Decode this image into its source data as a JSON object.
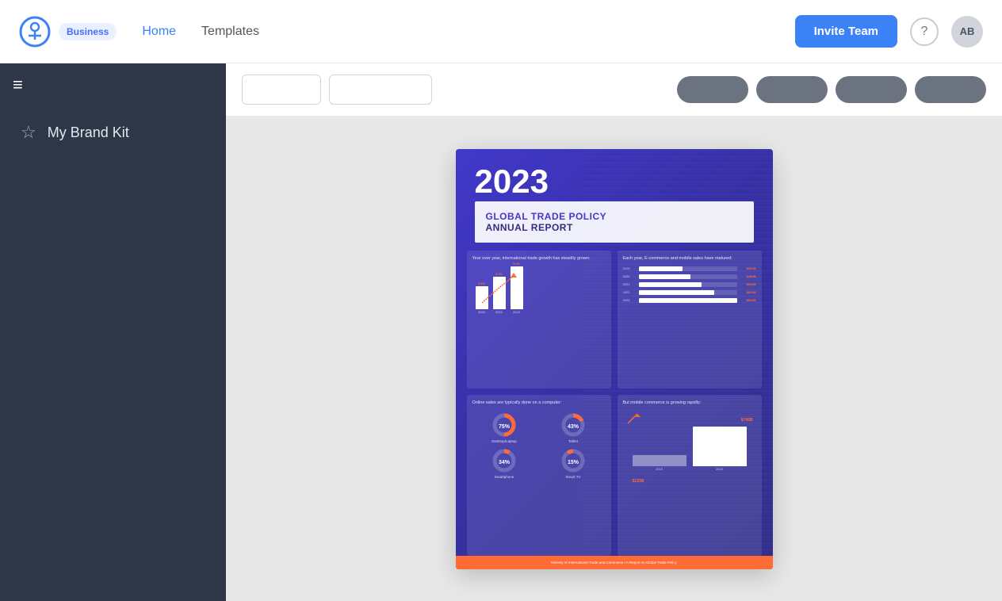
{
  "header": {
    "logo_badge": "Business",
    "nav_items": [
      {
        "label": "Home",
        "active": true
      },
      {
        "label": "Templates",
        "active": false
      }
    ],
    "invite_btn": "Invite Team",
    "help_icon": "?",
    "avatar_initials": "AB"
  },
  "sidebar": {
    "menu_icon": "≡",
    "items": [
      {
        "icon": "★",
        "label": "My Brand Kit"
      }
    ]
  },
  "toolbar": {
    "input1_placeholder": "",
    "input2_placeholder": "",
    "pill_labels": [
      "",
      "",
      "",
      ""
    ]
  },
  "document": {
    "year": "2023",
    "title_line1": "GLOBAL TRADE POLICY",
    "title_line2": "ANNUAL REPORT",
    "chart_left_title": "Year over year, international trade growth has steadily grown:",
    "chart_right_title": "Each year, E-commerce and mobile sales have matured:",
    "vertical_bars": [
      {
        "label": "2020",
        "value_pct": 48,
        "top_label": "2.5%"
      },
      {
        "label": "2021",
        "value_pct": 68,
        "top_label": "3.7%"
      },
      {
        "label": "2022",
        "value_pct": 90,
        "top_label": "5.2%"
      }
    ],
    "horizontal_bars": [
      {
        "year": "2019",
        "pct": 45,
        "value": "$237B"
      },
      {
        "year": "2020",
        "pct": 53,
        "value": "$280B"
      },
      {
        "year": "2021",
        "pct": 64,
        "value": "$340B"
      },
      {
        "year": "2022",
        "pct": 77,
        "value": "$410B"
      },
      {
        "year": "2023",
        "pct": 100,
        "value": "$530B"
      }
    ],
    "chart_bottom_left_title": "Online sales are typically done on a computer:",
    "chart_bottom_right_title": "But mobile commerce is growing rapidly:",
    "donuts": [
      {
        "pct": 75,
        "label": "Desktop/Laptop"
      },
      {
        "pct": 43,
        "label": "Tablet"
      },
      {
        "pct": 34,
        "label": "Smartphone"
      },
      {
        "pct": 15,
        "label": "Smart TV"
      }
    ],
    "mini_bars": [
      {
        "year": "2015",
        "height_pct": 22,
        "value": "$133B"
      },
      {
        "year": "2022",
        "height_pct": 100,
        "value": "$745B"
      }
    ],
    "footer_text": "Ministry of International Trade and Commerce / A Report on Global Trade Policy"
  }
}
